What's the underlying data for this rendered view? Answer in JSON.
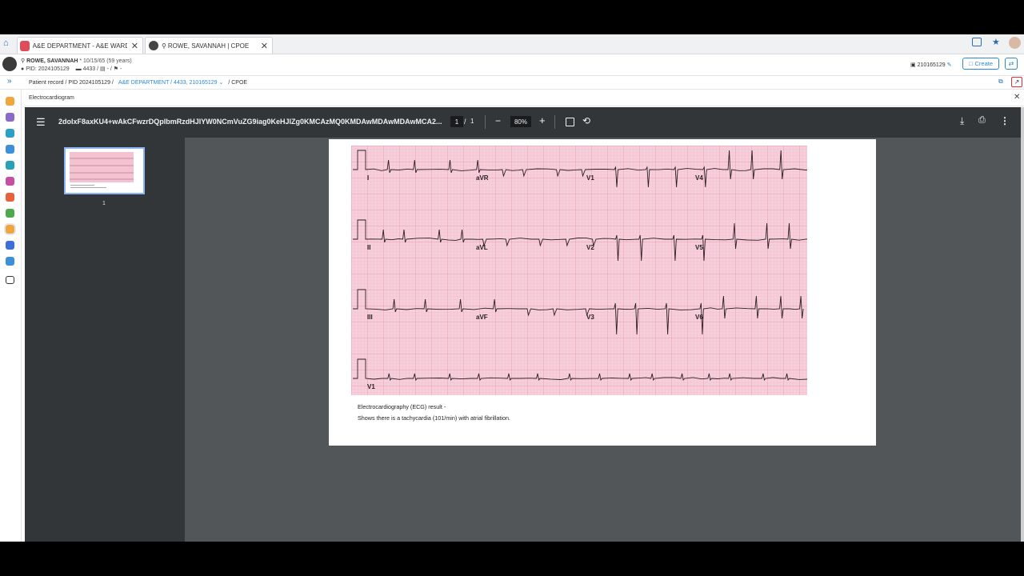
{
  "tabs": [
    {
      "label": "A&E DEPARTMENT - A&E WARD |..."
    },
    {
      "label": "ROWE, SAVANNAH | CPOE"
    }
  ],
  "patient": {
    "name": "ROWE, SAVANNAH",
    "dob": "* 10/15/65 (59 years)",
    "pid": "PID: 2024105129",
    "bed": "4433",
    "extra": "/ ▤ - / ⚑ -",
    "encounter": "210165129",
    "create_label": "Create"
  },
  "breadcrumb": {
    "record": "Patient record / PID 2024105129 /",
    "department": "A&E DEPARTMENT / 4433, 210165129",
    "current": "/ CPOE"
  },
  "panel": {
    "title": "Electrocardiogram"
  },
  "pdf": {
    "filename": "2doIxF8axKU4+wAkCFwzrDQplbmRzdHJlYW0NCmVuZG9iag0KeHJlZg0KMCAzMQ0KMDAwMDAwMDAwMCA2...",
    "page_current": "1",
    "page_sep": "/",
    "page_total": "1",
    "zoom": "80%",
    "thumb_label": "1",
    "caption_line1": "Electrocardiography (ECG) result -",
    "caption_line2": "Shows there is a tachycardia (101/min) with atrial fibrillation."
  },
  "ecg_leads": {
    "row1": [
      "I",
      "aVR",
      "V1",
      "V4"
    ],
    "row2": [
      "II",
      "aVL",
      "V2",
      "V5"
    ],
    "row3": [
      "III",
      "aVF",
      "V3",
      "V6"
    ],
    "row4": [
      "V1"
    ]
  },
  "colors": {
    "accent": "#1e88c9",
    "viewer_bg": "#525659",
    "toolbar_bg": "#323639",
    "ecg_paper": "#f5c9d6",
    "ecg_grid": "#e48aa6"
  }
}
